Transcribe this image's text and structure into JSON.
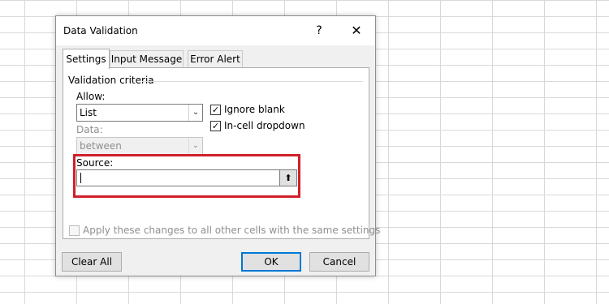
{
  "dialog": {
    "title": "Data Validation",
    "help_glyph": "?",
    "close_glyph": "✕"
  },
  "tabs": [
    {
      "label": "Settings",
      "active": true
    },
    {
      "label": "Input Message",
      "active": false
    },
    {
      "label": "Error Alert",
      "active": false
    }
  ],
  "settings": {
    "group_title": "Validation criteria",
    "allow_label": "Allow:",
    "allow_value": "List",
    "data_label": "Data:",
    "data_value": "between",
    "ignore_blank_label": "Ignore blank",
    "ignore_blank_checked": true,
    "incell_dropdown_label": "In-cell dropdown",
    "incell_dropdown_checked": true,
    "source_label": "Source:",
    "source_value": "",
    "apply_all_label": "Apply these changes to all other cells with the same settings",
    "apply_all_checked": false
  },
  "buttons": {
    "clear_all": "Clear All",
    "ok": "OK",
    "cancel": "Cancel"
  },
  "glyphs": {
    "dropdown_arrow": "⌄",
    "checkmark": "✓",
    "collapse": "⬆"
  },
  "colors": {
    "highlight": "#d0202a",
    "primary_border": "#0078d7"
  }
}
